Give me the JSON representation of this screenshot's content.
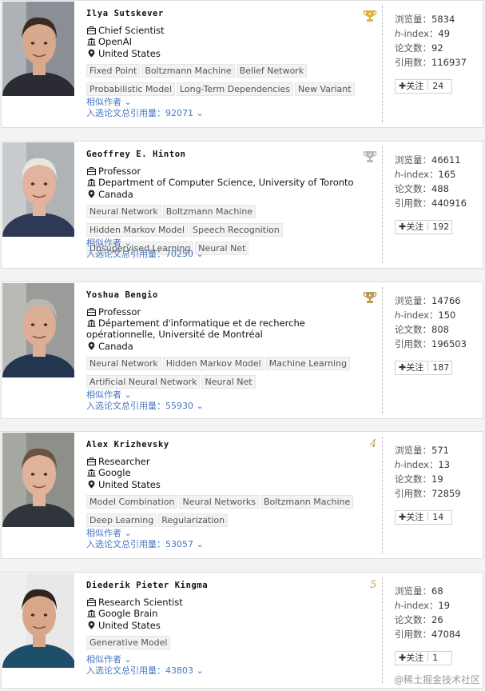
{
  "labels": {
    "views": "浏览量：",
    "hindex_h": "h",
    "hindex_rest": "-index：",
    "papers": "论文数：",
    "citations": "引用数：",
    "follow": "关注",
    "similar": "相似作者",
    "selected_citations": "入选论文总引用量："
  },
  "colors": {
    "gold_cup": "#e0b23a",
    "silver_cup": "#b9b9b9",
    "link": "#4a77c2",
    "rank_number": "#c59a5a"
  },
  "icons": {
    "title": "briefcase-icon",
    "org": "institution-icon",
    "location": "location-pin-icon"
  },
  "scholars": [
    {
      "name": "Ilya Sutskever",
      "title": "Chief Scientist",
      "org": "OpenAI",
      "location": "United States",
      "tags": [
        "Fixed Point",
        "Boltzmann Machine",
        "Belief Network",
        "Probabilistic Model",
        "Long-Term Dependencies",
        "New Variant"
      ],
      "selected_citations": "92071",
      "views": "5834",
      "hindex": "49",
      "papers": "92",
      "citations": "116937",
      "followers": "24",
      "rank_badge": "gold-cup-icon",
      "rank_number": ""
    },
    {
      "name": "Geoffrey E. Hinton",
      "title": "Professor",
      "org": "Department of Computer Science, University of Toronto",
      "location": "Canada",
      "tags": [
        "Neural Network",
        "Boltzmann Machine",
        "Hidden Markov Model",
        "Speech Recognition",
        "Unsupervised Learning",
        "Neural Net"
      ],
      "selected_citations": "70250",
      "views": "46611",
      "hindex": "165",
      "papers": "488",
      "citations": "440916",
      "followers": "192",
      "rank_badge": "silver-cup-icon",
      "rank_number": ""
    },
    {
      "name": "Yoshua Bengio",
      "title": "Professor",
      "org": "Département d'informatique et de recherche opérationnelle, Université de Montréal",
      "location": "Canada",
      "tags": [
        "Neural Network",
        "Hidden Markov Model",
        "Machine Learning",
        "Artificial Neural Network",
        "Neural Net"
      ],
      "selected_citations": "55930",
      "views": "14766",
      "hindex": "150",
      "papers": "808",
      "citations": "196503",
      "followers": "187",
      "rank_badge": "bronze-cup-icon",
      "rank_number": ""
    },
    {
      "name": "Alex Krizhevsky",
      "title": "Researcher",
      "org": "Google",
      "location": "United States",
      "tags": [
        "Model Combination",
        "Neural Networks",
        "Boltzmann Machine",
        "Deep Learning",
        "Regularization"
      ],
      "selected_citations": "53057",
      "views": "571",
      "hindex": "13",
      "papers": "19",
      "citations": "72859",
      "followers": "14",
      "rank_badge": "",
      "rank_number": "4"
    },
    {
      "name": "Diederik Pieter Kingma",
      "title": "Research Scientist",
      "org": "Google Brain",
      "location": "United States",
      "tags": [
        "Generative Model"
      ],
      "selected_citations": "43803",
      "views": "68",
      "hindex": "19",
      "papers": "26",
      "citations": "47084",
      "followers": "1",
      "rank_badge": "",
      "rank_number": "5"
    }
  ],
  "watermark": "@稀土掘金技术社区"
}
